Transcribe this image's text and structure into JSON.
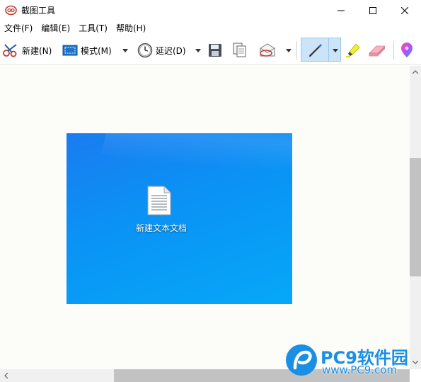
{
  "window": {
    "title": "截图工具",
    "minimize_icon": "minimize-icon",
    "maximize_icon": "maximize-icon",
    "close_icon": "close-icon"
  },
  "menu": {
    "items": [
      {
        "label": "文件(F)"
      },
      {
        "label": "编辑(E)"
      },
      {
        "label": "工具(T)"
      },
      {
        "label": "帮助(H)"
      }
    ]
  },
  "toolbar": {
    "new_label": "新建(N)",
    "mode_label": "模式(M)",
    "delay_label": "延迟(D)",
    "icons": [
      "scissors-icon",
      "mode-rect-icon",
      "clock-icon",
      "save-icon",
      "copy-icon",
      "send-email-icon",
      "pen-icon",
      "highlighter-icon",
      "eraser-icon",
      "paint3d-icon"
    ],
    "selected_tool": "pen"
  },
  "capture": {
    "desktop_file_label": "新建文本文档"
  },
  "watermark": {
    "title": "PC9软件园",
    "url": "www.PC9.com"
  },
  "colors": {
    "accent": "#1a8fe3",
    "selected_tool_bg": "#cce4f7",
    "desktop_blue": "#0a93f5"
  }
}
